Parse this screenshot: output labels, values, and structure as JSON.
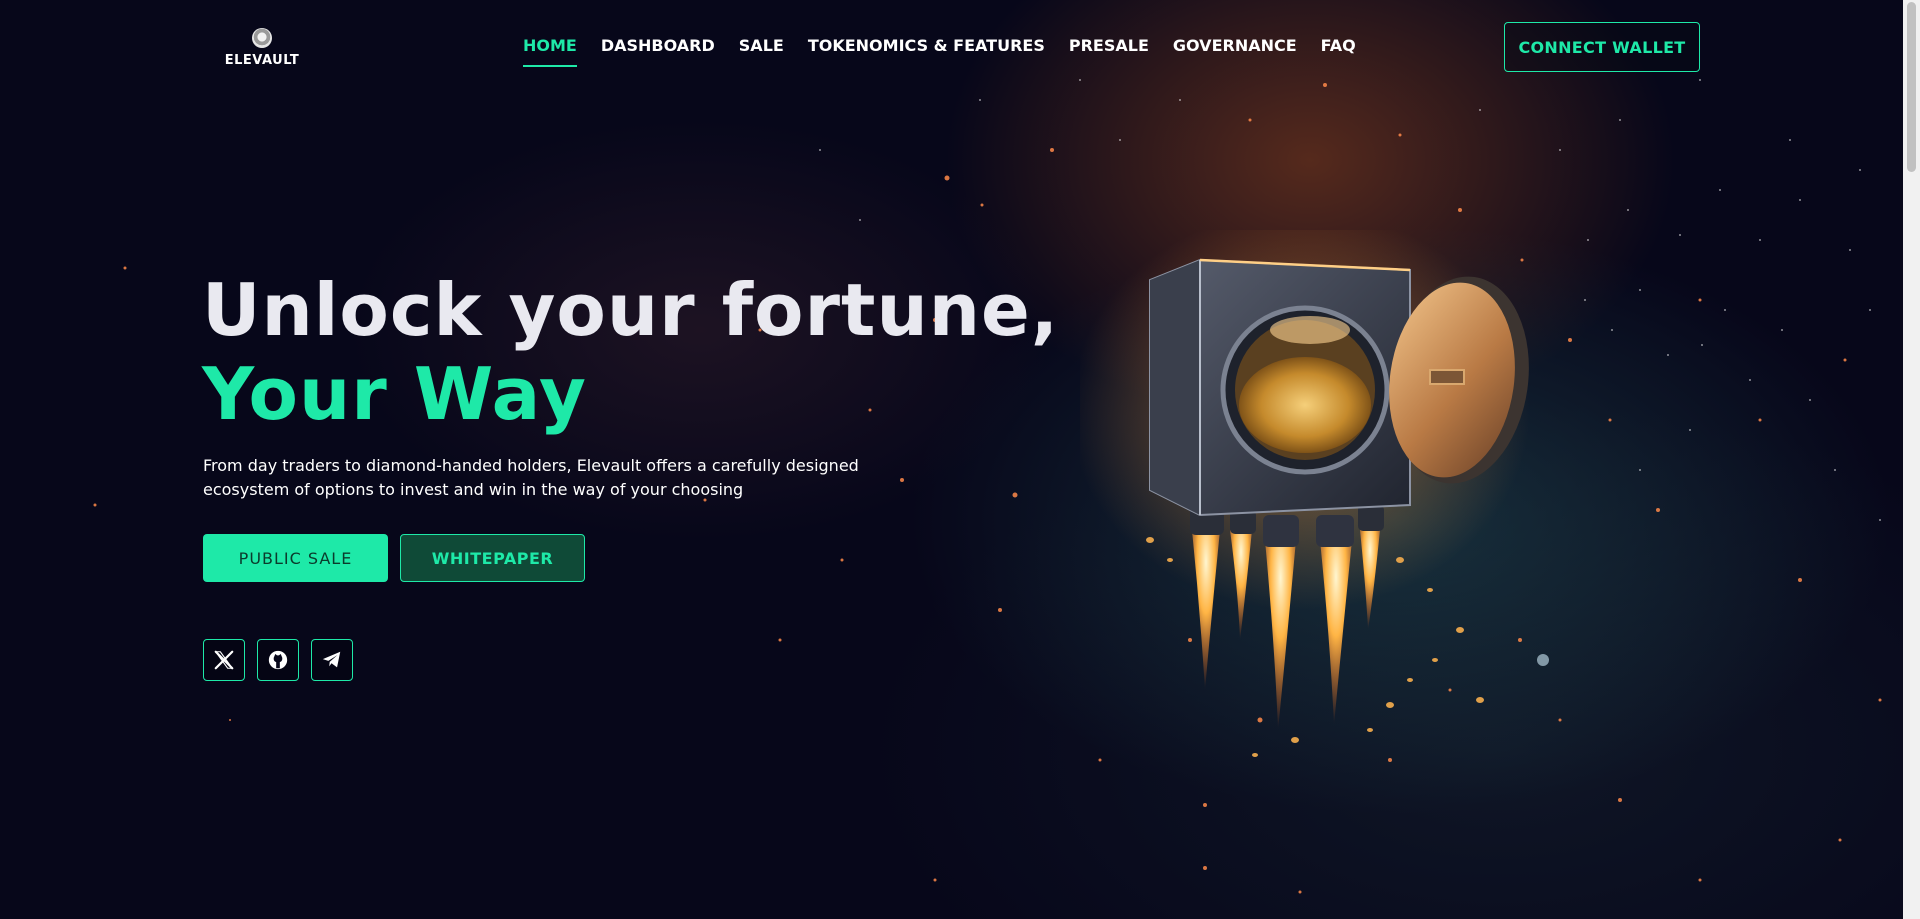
{
  "header": {
    "logo_text": "ELEVAULT",
    "nav": [
      {
        "label": "HOME",
        "active": true
      },
      {
        "label": "DASHBOARD",
        "active": false
      },
      {
        "label": "SALE",
        "active": false
      },
      {
        "label": "TOKENOMICS & FEATURES",
        "active": false
      },
      {
        "label": "PRESALE",
        "active": false
      },
      {
        "label": "GOVERNANCE",
        "active": false
      },
      {
        "label": "FAQ",
        "active": false
      }
    ],
    "connect_label": "CONNECT WALLET"
  },
  "hero": {
    "title_line1": "Unlock your fortune,",
    "title_line2": "Your Way",
    "description": "From day traders to diamond-handed holders, Elevault offers a carefully designed ecosystem of options to invest and win in the way of your choosing",
    "primary_button": "PUBLIC SALE",
    "secondary_button": "WHITEPAPER",
    "socials": [
      {
        "icon": "x-twitter-icon"
      },
      {
        "icon": "github-icon"
      },
      {
        "icon": "telegram-icon"
      }
    ]
  },
  "colors": {
    "accent": "#1ee9a8",
    "background": "#07071a",
    "title": "#e9e9f0"
  }
}
